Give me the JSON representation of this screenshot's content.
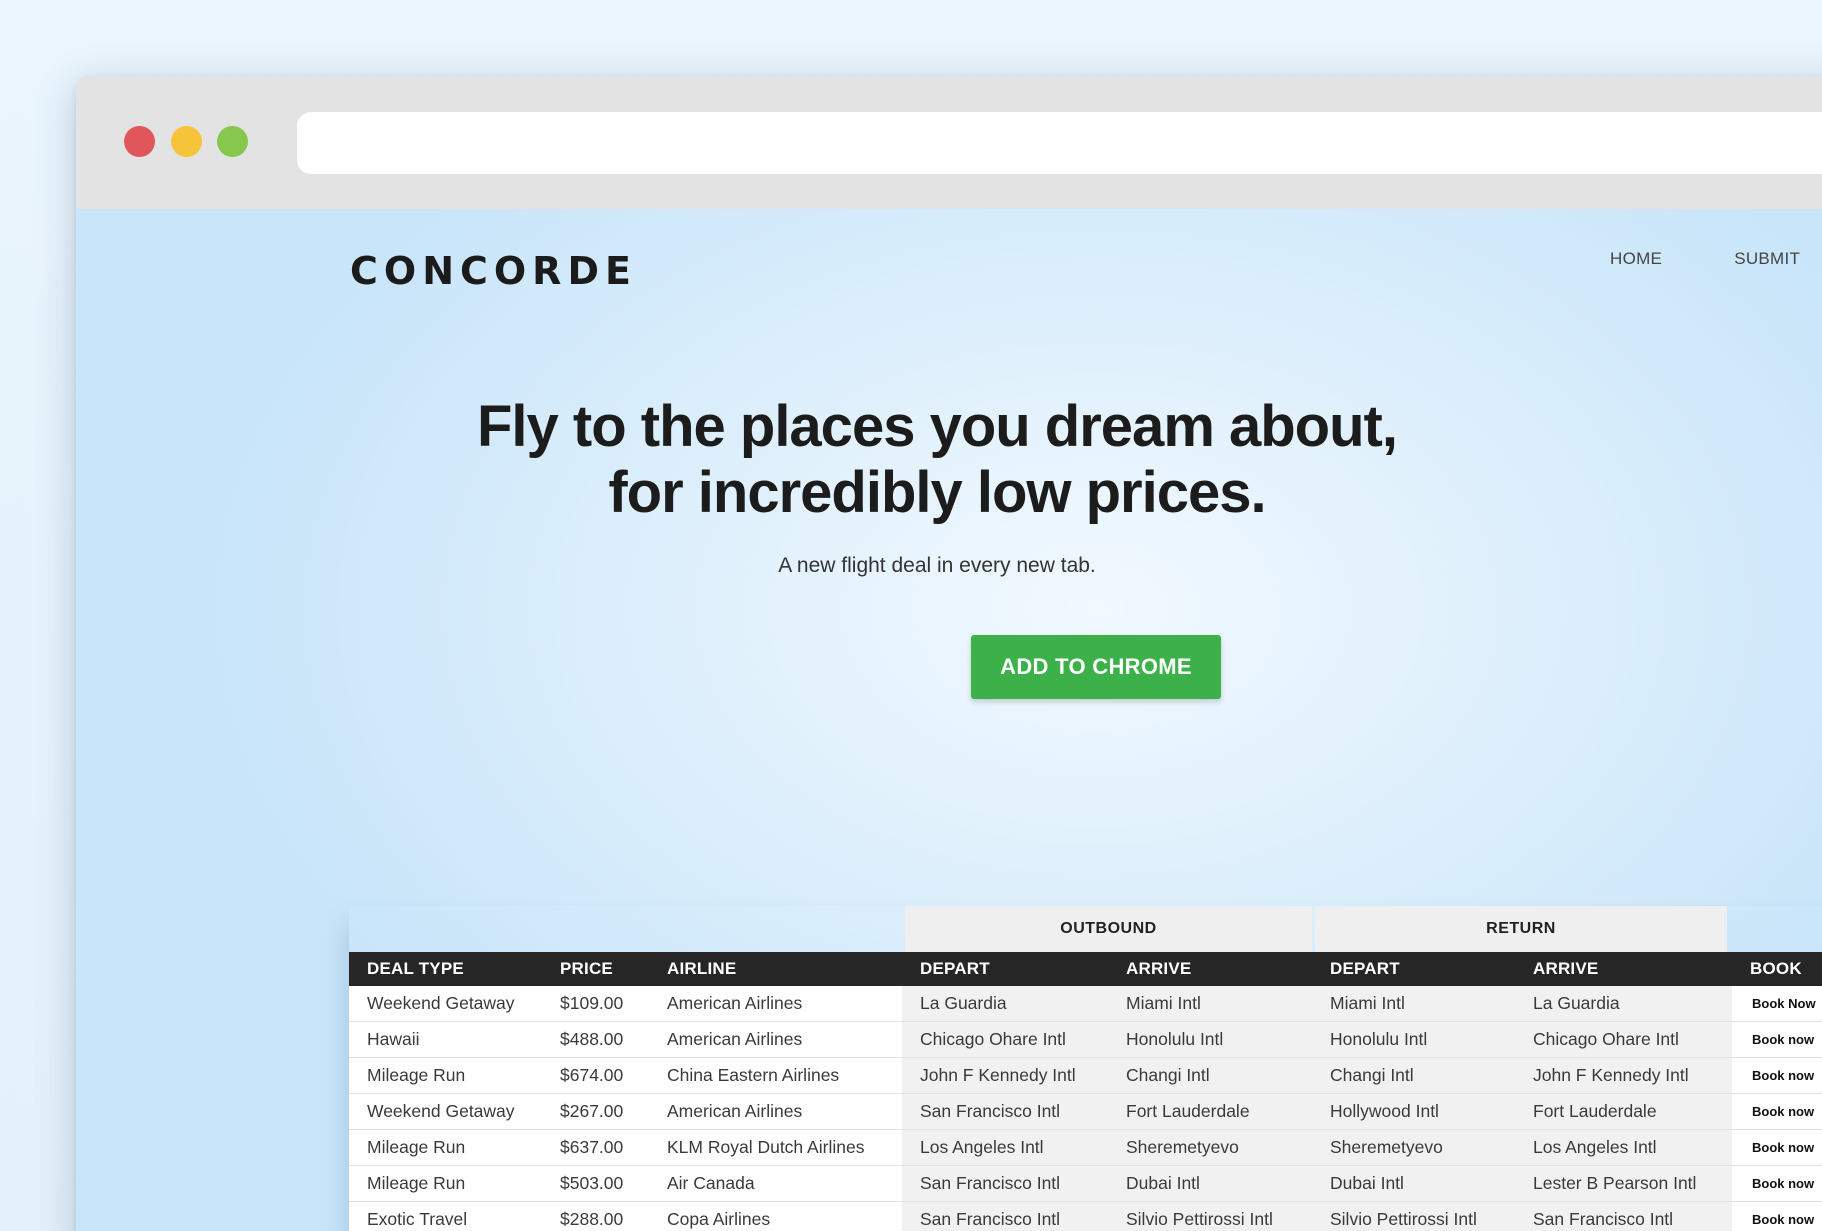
{
  "site": {
    "logo": "CONCORDE",
    "nav": [
      {
        "label": "HOME"
      },
      {
        "label": "SUBMIT"
      }
    ]
  },
  "hero": {
    "title_line1": "Fly to the places you dream about,",
    "title_line2": "for incredibly low prices.",
    "subtitle": "A new flight deal in every new tab.",
    "cta_label": "ADD TO CHROME",
    "cta_color": "#3cb14a"
  },
  "table": {
    "groups": {
      "outbound": "OUTBOUND",
      "return": "RETURN"
    },
    "headers": [
      "DEAL TYPE",
      "PRICE",
      "AIRLINE",
      "DEPART",
      "ARRIVE",
      "DEPART",
      "ARRIVE",
      "BOOK"
    ],
    "rows": [
      {
        "deal_type": "Weekend Getaway",
        "price": "$109.00",
        "airline": "American Airlines",
        "out_depart": "La Guardia",
        "out_arrive": "Miami Intl",
        "ret_depart": "Miami Intl",
        "ret_arrive": "La Guardia",
        "book": "Book Now"
      },
      {
        "deal_type": "Hawaii",
        "price": "$488.00",
        "airline": "American Airlines",
        "out_depart": "Chicago Ohare Intl",
        "out_arrive": "Honolulu Intl",
        "ret_depart": "Honolulu Intl",
        "ret_arrive": "Chicago Ohare Intl",
        "book": "Book now"
      },
      {
        "deal_type": "Mileage Run",
        "price": "$674.00",
        "airline": "China Eastern Airlines",
        "out_depart": "John F Kennedy Intl",
        "out_arrive": "Changi Intl",
        "ret_depart": "Changi Intl",
        "ret_arrive": "John F Kennedy Intl",
        "book": "Book now"
      },
      {
        "deal_type": "Weekend Getaway",
        "price": "$267.00",
        "airline": "American Airlines",
        "out_depart": "San Francisco Intl",
        "out_arrive": "Fort Lauderdale",
        "ret_depart": "Hollywood Intl",
        "ret_arrive": "Fort Lauderdale",
        "book": "Book now"
      },
      {
        "deal_type": "Mileage Run",
        "price": "$637.00",
        "airline": "KLM Royal Dutch Airlines",
        "out_depart": "Los Angeles Intl",
        "out_arrive": "Sheremetyevo",
        "ret_depart": "Sheremetyevo",
        "ret_arrive": "Los Angeles Intl",
        "book": "Book now"
      },
      {
        "deal_type": "Mileage Run",
        "price": "$503.00",
        "airline": "Air Canada",
        "out_depart": "San Francisco Intl",
        "out_arrive": "Dubai Intl",
        "ret_depart": "Dubai Intl",
        "ret_arrive": "Lester B Pearson Intl",
        "book": "Book now"
      },
      {
        "deal_type": "Exotic Travel",
        "price": "$288.00",
        "airline": "Copa Airlines",
        "out_depart": "San Francisco Intl",
        "out_arrive": "Silvio Pettirossi Intl",
        "ret_depart": "Silvio Pettirossi Intl",
        "ret_arrive": "San Francisco Intl",
        "book": "Book now"
      }
    ]
  },
  "window": {
    "traffic_lights": {
      "close": "#e0565a",
      "minimize": "#f6c33a",
      "maximize": "#86c74d"
    },
    "address": ""
  }
}
